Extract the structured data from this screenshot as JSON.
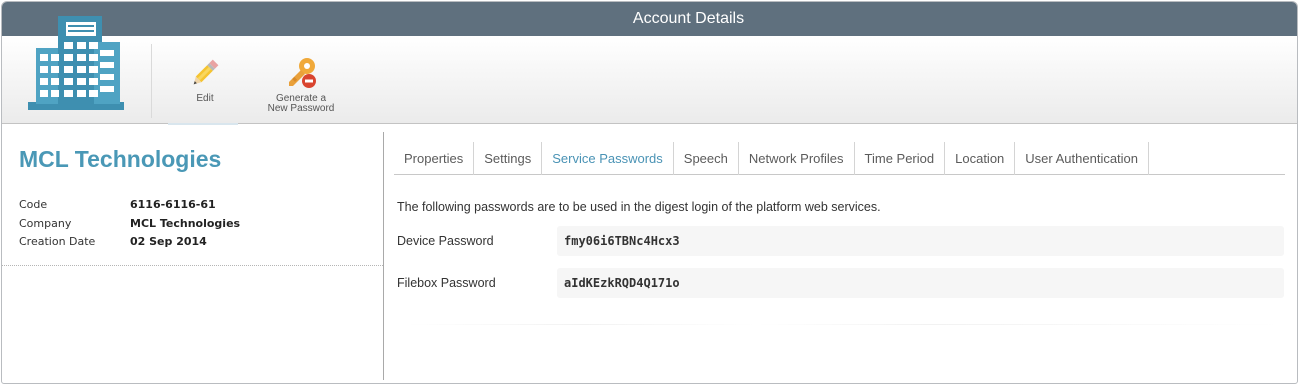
{
  "window": {
    "title": "Account Details"
  },
  "toolbar": {
    "edit_label": "Edit",
    "generate_label_line1": "Generate a",
    "generate_label_line2": "New Password"
  },
  "account": {
    "name": "MCL Technologies",
    "fields": [
      {
        "label": "Code",
        "value": "6116-6116-61"
      },
      {
        "label": "Company",
        "value": "MCL Technologies"
      },
      {
        "label": "Creation Date",
        "value": "02 Sep 2014"
      }
    ]
  },
  "tabs": [
    {
      "label": "Properties"
    },
    {
      "label": "Settings"
    },
    {
      "label": "Service Passwords",
      "active": true
    },
    {
      "label": "Speech"
    },
    {
      "label": "Network Profiles"
    },
    {
      "label": "Time Period"
    },
    {
      "label": "Location"
    },
    {
      "label": "User Authentication"
    }
  ],
  "service_passwords": {
    "description": "The following passwords are to be used in the digest login of the platform web services.",
    "device": {
      "label": "Device Password",
      "value": "fmy06i6TBNc4Hcx3"
    },
    "filebox": {
      "label": "Filebox Password",
      "value": "aIdKEzkRQD4Q171o"
    }
  },
  "icons": {
    "logo": "building-icon",
    "edit": "pencil-icon",
    "generate": "key-icon"
  },
  "colors": {
    "titlebar": "#5f707e",
    "accent": "#4a98b6",
    "logo": "#3e8fb0"
  }
}
